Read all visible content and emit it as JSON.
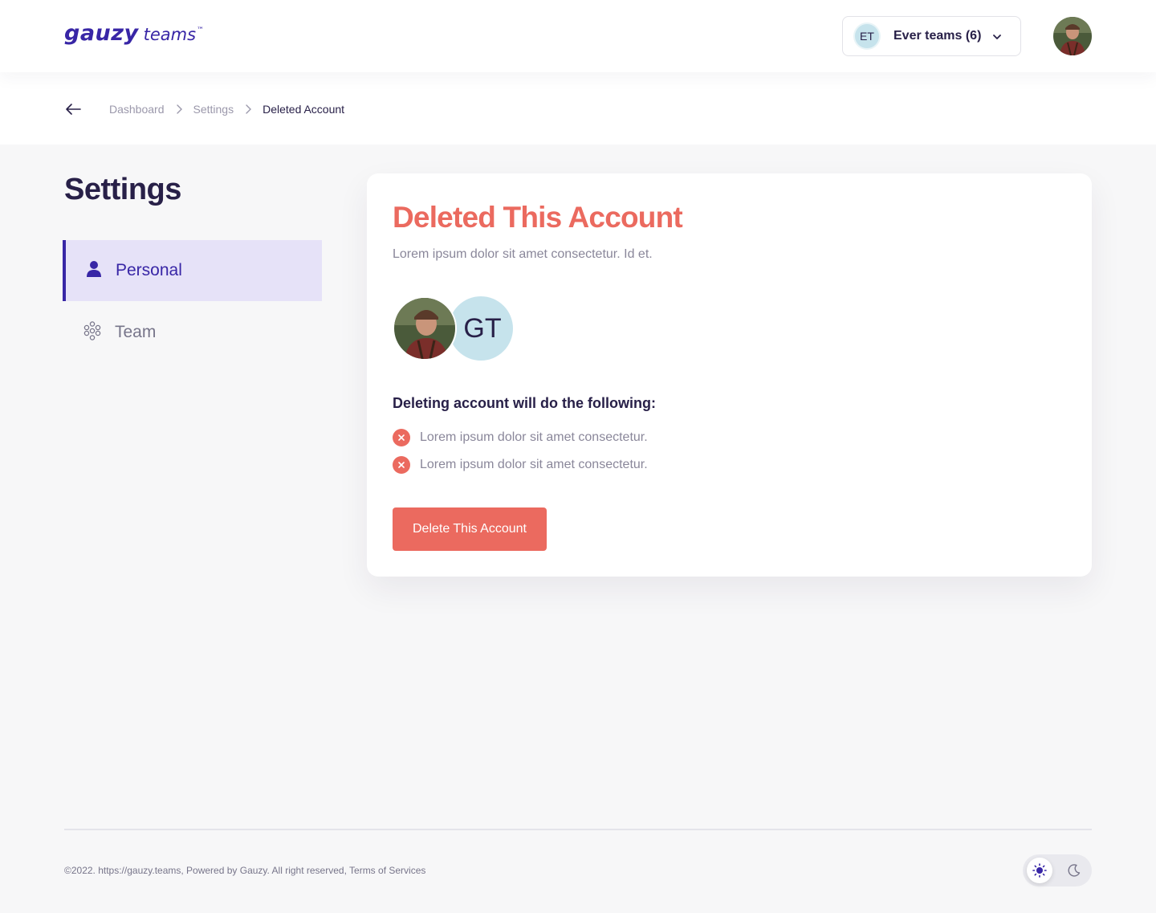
{
  "header": {
    "logo_main": "gauzy",
    "logo_sub": "teams",
    "logo_tm": "™",
    "team_initials": "ET",
    "team_name": "Ever teams (6)",
    "icons": {
      "dropdown": "chevron-down-icon",
      "user": "user-avatar-photo"
    }
  },
  "breadcrumb": {
    "items": [
      "Dashboard",
      "Settings",
      "Deleted Account"
    ],
    "back_icon": "arrow-left-icon",
    "separator_icon": "chevron-right-icon"
  },
  "sidebar": {
    "title": "Settings",
    "items": [
      {
        "label": "Personal",
        "icon": "user-icon",
        "active": true
      },
      {
        "label": "Team",
        "icon": "team-icon",
        "active": false
      }
    ]
  },
  "card": {
    "title": "Deleted This Account",
    "subtitle": "Lorem ipsum dolor sit amet consectetur. Id et.",
    "avatar_initials": "GT",
    "list_heading": "Deleting account will do the following:",
    "list_items": [
      "Lorem ipsum dolor sit amet consectetur.",
      "Lorem ipsum dolor sit amet consectetur."
    ],
    "button_label": "Delete This Account"
  },
  "footer": {
    "text": "©2022. https://gauzy.teams, Powered by Gauzy. All right reserved, Terms of Services",
    "theme_icons": [
      "sun-icon",
      "moon-icon"
    ]
  },
  "colors": {
    "brand": "#3826a6",
    "danger": "#eb6a5f",
    "text": "#282048",
    "muted": "#8a879a",
    "active_bg": "#e6e2f8",
    "avatar_bg": "#c6e3ec"
  }
}
